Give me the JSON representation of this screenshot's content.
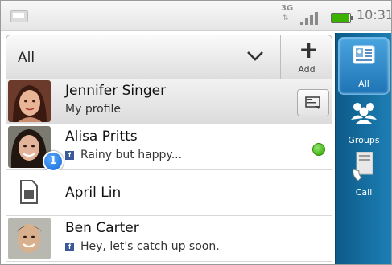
{
  "status_bar": {
    "network": "3G",
    "time": "10:31",
    "battery_color": "#3cb200"
  },
  "filter": {
    "selected": "All",
    "add_label": "Add"
  },
  "contacts": [
    {
      "name": "Jennifer Singer",
      "subtitle": "My profile",
      "type": "profile"
    },
    {
      "name": "Alisa Pritts",
      "status": "Rainy but happy...",
      "badge": "1",
      "online": true
    },
    {
      "name": "April Lin",
      "source_icon": "sim-card-icon"
    },
    {
      "name": "Ben Carter",
      "status": "Hey, let's catch up soon."
    }
  ],
  "tabs": [
    {
      "label": "All",
      "icon": "contact-card-icon",
      "active": true
    },
    {
      "label": "Groups",
      "icon": "groups-icon"
    },
    {
      "label": "Call",
      "icon": "call-history-icon"
    }
  ],
  "colors": {
    "tab_bar": "#1d7fb5",
    "facebook": "#3b5998",
    "online": "#2ea000",
    "badge": "#1468d8"
  }
}
